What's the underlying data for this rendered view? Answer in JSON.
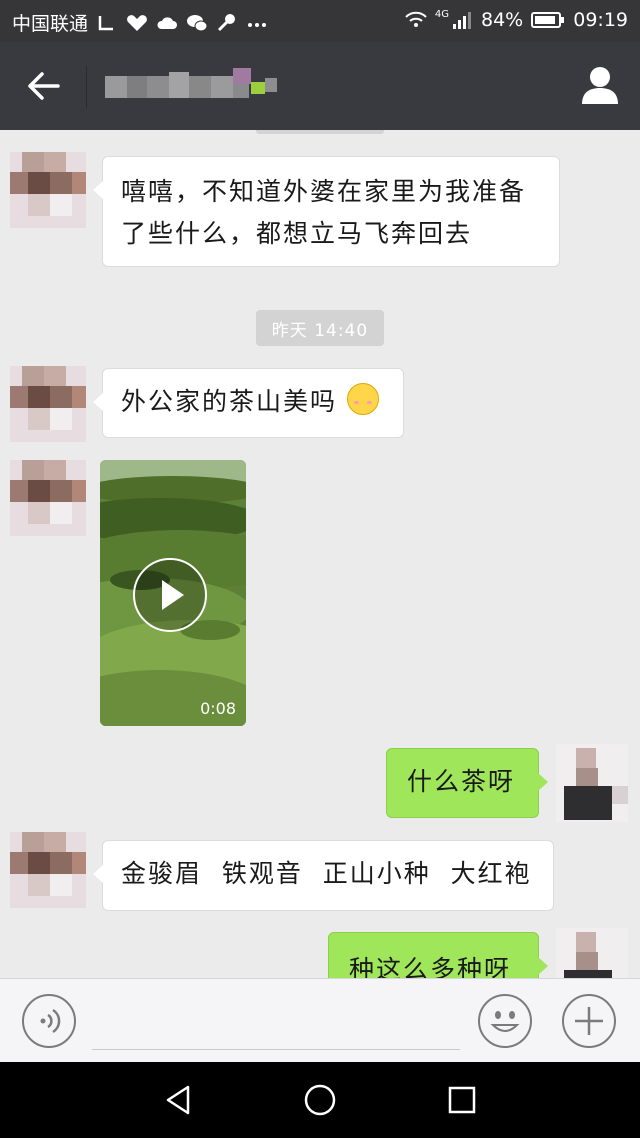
{
  "status_bar": {
    "carrier": "中国联通",
    "network_type": "4G",
    "battery": "84%",
    "time": "09:19"
  },
  "chat": {
    "messages": [
      {
        "side": "left",
        "type": "text",
        "text": "嘻嘻，不知道外婆在家里为我准备了些什么，都想立马飞奔回去"
      },
      {
        "type": "timestamp",
        "text": "昨天 14:40"
      },
      {
        "side": "left",
        "type": "text",
        "text": "外公家的茶山美吗",
        "emoji": "smiling-face-emoji"
      },
      {
        "side": "left",
        "type": "video",
        "duration": "0:08"
      },
      {
        "side": "right",
        "type": "text",
        "text": "什么茶呀"
      },
      {
        "side": "left",
        "type": "text",
        "text": "金骏眉  铁观音  正山小种  大红袍"
      },
      {
        "side": "right",
        "type": "text",
        "text": "种这么多种呀"
      }
    ]
  },
  "colors": {
    "status_bar_bg": "#363638",
    "title_bar_bg": "#393a3f",
    "chat_bg": "#ebebeb",
    "incoming_bubble": "#ffffff",
    "outgoing_bubble": "#9fe65a",
    "timestamp_bg": "#d3d3d3"
  },
  "icons": {
    "back": "back-arrow-icon",
    "profile": "person-icon",
    "voice": "voice-input-icon",
    "emoji": "emoji-icon",
    "more": "plus-icon",
    "nav_back": "triangle-back-icon",
    "nav_home": "circle-home-icon",
    "nav_recent": "square-recent-icon"
  }
}
